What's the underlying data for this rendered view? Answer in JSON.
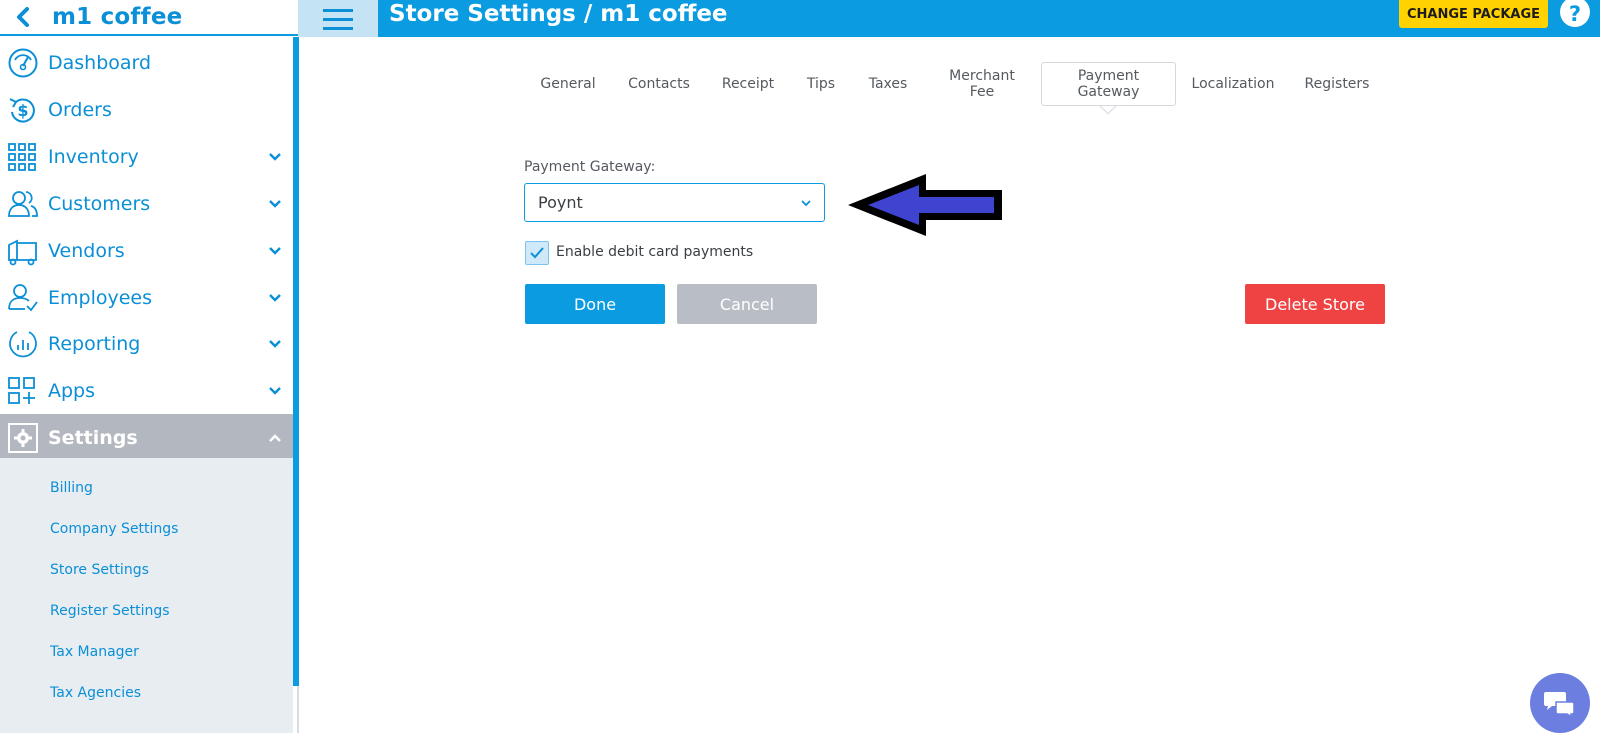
{
  "store": {
    "name": "m1 coffee"
  },
  "header": {
    "title": "Store Settings / m1 coffee",
    "change_package_label": "CHANGE PACKAGE",
    "help_label": "?"
  },
  "sidebar": {
    "items": [
      {
        "label": "Dashboard",
        "icon": "dashboard-gauge-icon"
      },
      {
        "label": "Orders",
        "icon": "dollar-cycle-icon"
      },
      {
        "label": "Inventory",
        "icon": "grid-icon"
      },
      {
        "label": "Customers",
        "icon": "users-icon"
      },
      {
        "label": "Vendors",
        "icon": "truck-icon"
      },
      {
        "label": "Employees",
        "icon": "employee-icon"
      },
      {
        "label": "Reporting",
        "icon": "chart-circle-icon"
      },
      {
        "label": "Apps",
        "icon": "apps-icon"
      },
      {
        "label": "Settings",
        "icon": "gear-icon"
      }
    ],
    "settings_subitems": [
      "Billing",
      "Company Settings",
      "Store Settings",
      "Register Settings",
      "Tax Manager",
      "Tax Agencies"
    ]
  },
  "tabs": [
    {
      "label": "General"
    },
    {
      "label": "Contacts"
    },
    {
      "label": "Receipt"
    },
    {
      "label": "Tips"
    },
    {
      "label": "Taxes"
    },
    {
      "label": "Merchant Fee"
    },
    {
      "label": "Payment Gateway"
    },
    {
      "label": "Localization"
    },
    {
      "label": "Registers"
    }
  ],
  "form": {
    "gateway_label": "Payment Gateway:",
    "gateway_value": "Poynt",
    "debit_label": "Enable debit card payments",
    "debit_checked": true,
    "done_label": "Done",
    "cancel_label": "Cancel",
    "delete_label": "Delete Store"
  },
  "colors": {
    "accent": "#0b9be0",
    "danger": "#ef4343",
    "package": "#ffd200",
    "arrow": "#3f44d0"
  }
}
